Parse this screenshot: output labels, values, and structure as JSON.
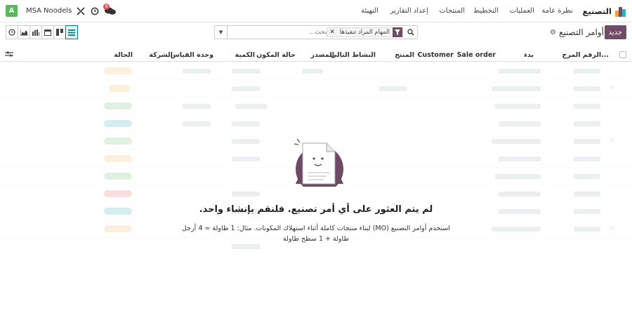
{
  "navbar": {
    "app_name": "التصنيع",
    "menu": [
      "نظرة عامة",
      "العمليات",
      "التخطيط",
      "المنتجات",
      "إعداد التقارير",
      "التهيئة"
    ],
    "company": "MSA Noodels",
    "avatar_letter": "A",
    "chat_count": "6",
    "icons": [
      "settings-tools-icon",
      "clock-icon",
      "chat-icon"
    ]
  },
  "control_panel": {
    "new_label": "جديد",
    "breadcrumb": "أوامر التصنيع",
    "search": {
      "facet": "المهام المراد تنفيذها",
      "placeholder": "بحث..."
    },
    "views": [
      "list-view-icon",
      "kanban-view-icon",
      "calendar-view-icon",
      "pivot-view-icon",
      "graph-view-icon",
      "activity-view-icon"
    ]
  },
  "table": {
    "columns": [
      "الرقم المرج...",
      "بدء",
      "Sale order",
      "Customer",
      "المنتج",
      "النشاط التالي",
      "المصدر",
      "حالة المكون",
      "الكمية",
      "وحدة القياس",
      "الشركة",
      "الحالة"
    ]
  },
  "empty_state": {
    "title": "لم يتم العثور على أي أمر تصنيع. فلنقم بإنشاء واحد.",
    "body_line1": "استخدم أوامر التصنيع (MO) لبناء منتجات كاملة أثناء استهلاك المكونات. مثال: 1 طاولة = 4 أرجل",
    "body_line2": "طاولة + 1 سطح طاولة"
  },
  "colors": {
    "brand": "#714B67",
    "accent": "#017e84",
    "avatar": "#5cb85c",
    "badge": "#d9534f"
  }
}
